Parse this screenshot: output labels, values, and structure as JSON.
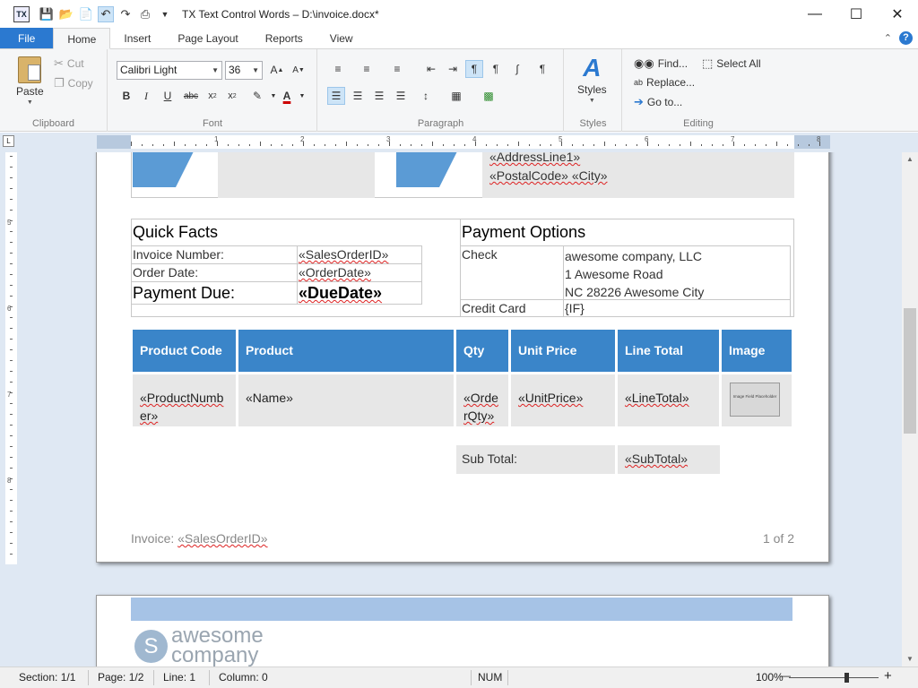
{
  "window": {
    "app_icon_label": "TX",
    "title": "TX Text Control Words – D:\\invoice.docx*",
    "minimize": "—",
    "maximize": "☐",
    "close": "✕"
  },
  "tabs": [
    "File",
    "Home",
    "Insert",
    "Page Layout",
    "Reports",
    "View"
  ],
  "ribbon": {
    "clipboard": {
      "label": "Clipboard",
      "paste": "Paste",
      "cut": "Cut",
      "copy": "Copy"
    },
    "font": {
      "label": "Font",
      "family": "Calibri Light",
      "size": "36"
    },
    "paragraph": {
      "label": "Paragraph"
    },
    "styles": {
      "label": "Styles",
      "button": "Styles"
    },
    "editing": {
      "label": "Editing",
      "find": "Find...",
      "replace": "Replace...",
      "goto": "Go to...",
      "select_all": "Select All"
    }
  },
  "ruler": {
    "numbers": [
      "1",
      "2",
      "3",
      "4",
      "5",
      "6",
      "7",
      "8"
    ],
    "vnumbers": [
      "5",
      "6",
      "7",
      "8"
    ]
  },
  "document": {
    "address_line": "«AddressLine1»",
    "postal_city": "«PostalCode» «City»",
    "quick_facts": {
      "title": "Quick Facts",
      "rows": [
        {
          "label": "Invoice Number:",
          "value": "«SalesOrderID»"
        },
        {
          "label": "Order Date:",
          "value": "«OrderDate»"
        },
        {
          "label": "Payment Due:",
          "value": "«DueDate»"
        }
      ]
    },
    "payment_options": {
      "title": "Payment Options",
      "check_label": "Check",
      "check_lines": [
        "awesome company, LLC",
        "1 Awesome Road",
        "NC 28226 Awesome City"
      ],
      "credit_label": "Credit Card",
      "credit_value": "{IF}"
    },
    "products": {
      "headers": [
        "Product Code",
        "Product",
        "Qty",
        "Unit Price",
        "Line Total",
        "Image"
      ],
      "row": [
        "«ProductNumber»",
        "«Name»",
        "«OrderQty»",
        "«UnitPrice»",
        "«LineTotal»"
      ],
      "image_placeholder": "Image Field Placeholder"
    },
    "subtotal": {
      "label": "Sub Total:",
      "value": "«SubTotal»"
    },
    "footer": {
      "invoice_prefix": "Invoice: ",
      "invoice_field": "«SalesOrderID»",
      "page": "1 of 2"
    },
    "page2": {
      "logo_letter": "S",
      "logo_line1": "awesome",
      "logo_line2": "company"
    }
  },
  "status": {
    "section": "Section: 1/1",
    "page": "Page: 1/2",
    "line": "Line: 1",
    "column": "Column: 0",
    "num": "NUM",
    "zoom": "100%",
    "zoom_minus": "—",
    "zoom_plus": "+"
  },
  "colors": {
    "accent": "#2b79d0",
    "table_header": "#3a85c9",
    "workspace": "#dfe8f3"
  }
}
